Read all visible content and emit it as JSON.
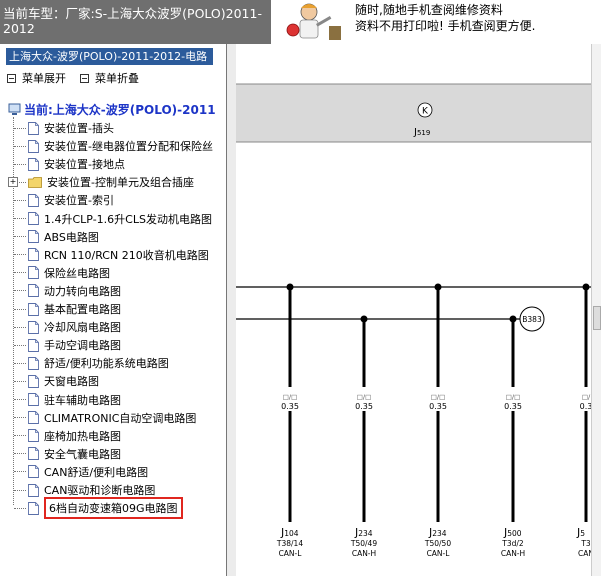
{
  "topbar": {
    "model_line1": "当前车型：厂家:S-上海大众波罗(POLO)2011-",
    "model_line2": "2012",
    "promo_line1": "随时,随地手机查阅维修资料",
    "promo_line2": "资料不用打印啦! 手机查阅更方便."
  },
  "leftpanel": {
    "header": "上海大众-波罗(POLO)-2011-2012-电路",
    "expand_menu": "菜单展开",
    "collapse_menu": "菜单折叠",
    "root_label": "当前:上海大众-波罗(POLO)-2011",
    "items": [
      {
        "label": "安装位置-插头",
        "type": "doc"
      },
      {
        "label": "安装位置-继电器位置分配和保险丝",
        "type": "doc"
      },
      {
        "label": "安装位置-接地点",
        "type": "doc"
      },
      {
        "label": "安装位置-控制单元及组合插座",
        "type": "folder"
      },
      {
        "label": "安装位置-索引",
        "type": "doc"
      },
      {
        "label": "1.4升CLP-1.6升CLS发动机电路图",
        "type": "doc"
      },
      {
        "label": "ABS电路图",
        "type": "doc"
      },
      {
        "label": "RCN 110/RCN 210收音机电路图",
        "type": "doc"
      },
      {
        "label": "保险丝电路图",
        "type": "doc"
      },
      {
        "label": "动力转向电路图",
        "type": "doc"
      },
      {
        "label": "基本配置电路图",
        "type": "doc"
      },
      {
        "label": "冷却风扇电路图",
        "type": "doc"
      },
      {
        "label": "手动空调电路图",
        "type": "doc"
      },
      {
        "label": "舒适/便利功能系统电路图",
        "type": "doc"
      },
      {
        "label": "天窗电路图",
        "type": "doc"
      },
      {
        "label": "驻车辅助电路图",
        "type": "doc"
      },
      {
        "label": "CLIMATRONIC自动空调电路图",
        "type": "doc"
      },
      {
        "label": "座椅加热电路图",
        "type": "doc"
      },
      {
        "label": "安全气囊电路图",
        "type": "doc"
      },
      {
        "label": "CAN舒适/便利电路图",
        "type": "doc"
      },
      {
        "label": "CAN驱动和诊断电路图",
        "type": "doc"
      },
      {
        "label": "6档自动变速箱09G电路图",
        "type": "doc",
        "selected": true
      }
    ]
  },
  "diagram": {
    "top_symbol": "K",
    "top_component_main": "J",
    "top_component_sub": "519",
    "splice": "B383",
    "wires": [
      {
        "code": "□/□",
        "gauge": "0.35",
        "comp": "J",
        "comp_sub": "104",
        "pin": "T38/14",
        "bus": "CAN-L"
      },
      {
        "code": "□/□",
        "gauge": "0.35",
        "comp": "J",
        "comp_sub": "234",
        "pin": "T50/49",
        "bus": "CAN-H"
      },
      {
        "code": "□/□",
        "gauge": "0.35",
        "comp": "J",
        "comp_sub": "234",
        "pin": "T50/50",
        "bus": "CAN-L"
      },
      {
        "code": "□/□",
        "gauge": "0.35",
        "comp": "J",
        "comp_sub": "500",
        "pin": "T3d/2",
        "bus": "CAN-H"
      },
      {
        "code": "□/",
        "gauge": "0.3",
        "comp": "J",
        "comp_sub": "5",
        "pin": "T3",
        "bus": "CAN"
      }
    ]
  }
}
